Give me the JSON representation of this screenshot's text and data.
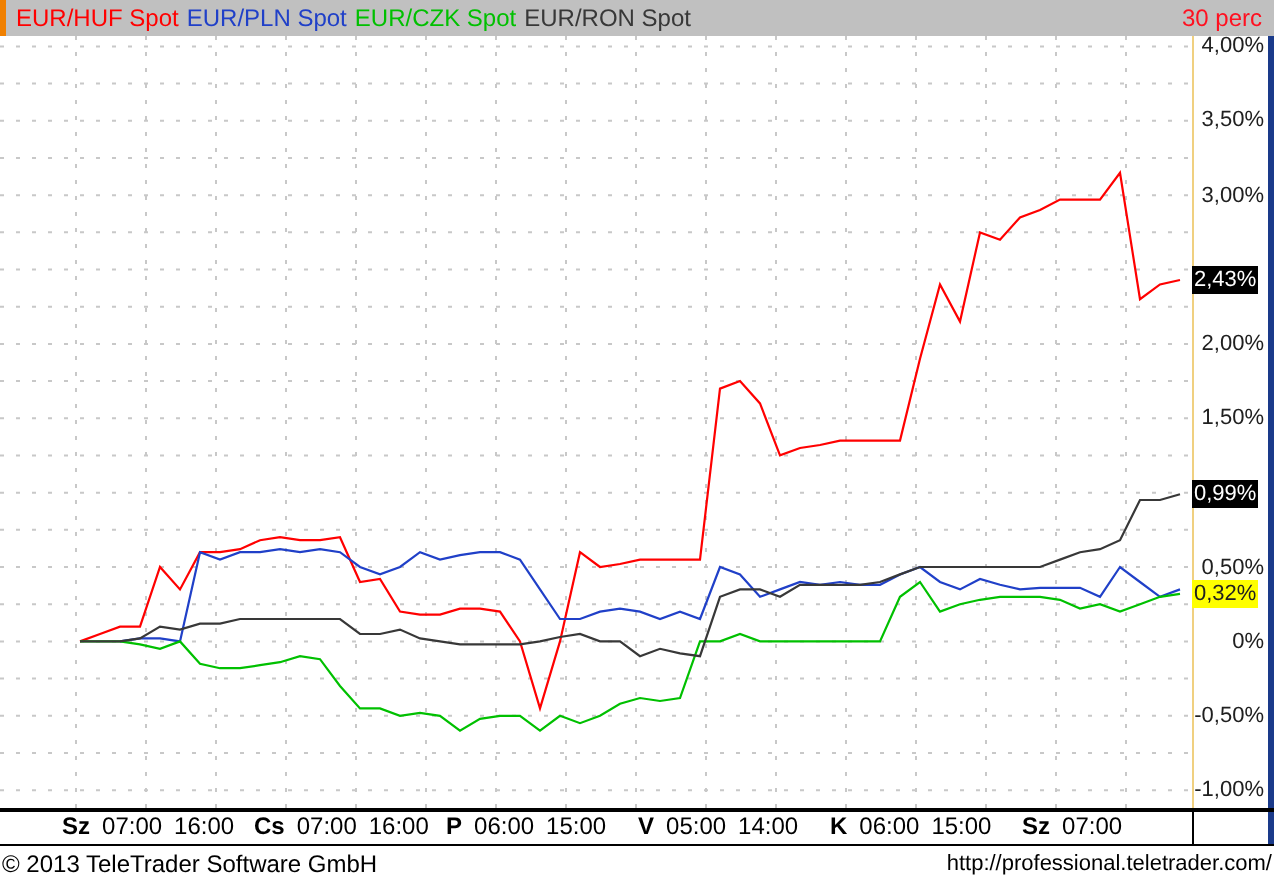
{
  "header": {
    "indicator": "30 perc"
  },
  "chart_data": {
    "type": "line",
    "grid": true,
    "ylim": [
      -1.12,
      4.07
    ],
    "yticks": [
      {
        "value": 4,
        "label": "4,00%"
      },
      {
        "value": 3.5,
        "label": "3,50%"
      },
      {
        "value": 3,
        "label": "3,00%"
      },
      {
        "value": 2,
        "label": "2,00%"
      },
      {
        "value": 1.5,
        "label": "1,50%"
      },
      {
        "value": 0.5,
        "label": "0,50%"
      },
      {
        "value": 0,
        "label": "0%"
      },
      {
        "value": -0.5,
        "label": "-0,50%"
      },
      {
        "value": -1,
        "label": "-1,00%"
      }
    ],
    "series": [
      {
        "name": "EUR/HUF Spot",
        "color": "#ff0000",
        "values": [
          0,
          0.05,
          0.1,
          0.1,
          0.5,
          0.35,
          0.6,
          0.6,
          0.62,
          0.68,
          0.7,
          0.68,
          0.68,
          0.7,
          0.4,
          0.42,
          0.2,
          0.18,
          0.18,
          0.22,
          0.22,
          0.2,
          0.0,
          -0.45,
          0.0,
          0.6,
          0.5,
          0.52,
          0.55,
          0.55,
          0.55,
          0.55,
          1.7,
          1.75,
          1.6,
          1.25,
          1.3,
          1.32,
          1.35,
          1.35,
          1.35,
          1.35,
          1.9,
          2.4,
          2.15,
          2.75,
          2.7,
          2.85,
          2.9,
          2.97,
          2.97,
          2.97,
          3.15,
          2.3,
          2.4,
          2.43
        ]
      },
      {
        "name": "EUR/PLN Spot",
        "color": "#2040c8",
        "values": [
          null,
          null,
          0,
          0.02,
          0.02,
          0,
          0.6,
          0.55,
          0.6,
          0.6,
          0.62,
          0.6,
          0.62,
          0.6,
          0.5,
          0.45,
          0.5,
          0.6,
          0.55,
          0.58,
          0.6,
          0.6,
          0.55,
          0.35,
          0.15,
          0.15,
          0.2,
          0.22,
          0.2,
          0.15,
          0.2,
          0.15,
          0.5,
          0.45,
          0.3,
          0.35,
          0.4,
          0.38,
          0.4,
          0.38,
          0.38,
          0.45,
          0.5,
          0.4,
          0.35,
          0.42,
          0.38,
          0.35,
          0.36,
          0.36,
          0.36,
          0.3,
          0.5,
          0.4,
          0.3,
          0.35
        ]
      },
      {
        "name": "EUR/CZK Spot",
        "color": "#00c000",
        "values": [
          0,
          0,
          0,
          -0.02,
          -0.05,
          0,
          -0.15,
          -0.18,
          -0.18,
          -0.16,
          -0.14,
          -0.1,
          -0.12,
          -0.3,
          -0.45,
          -0.45,
          -0.5,
          -0.48,
          -0.5,
          -0.6,
          -0.52,
          -0.5,
          -0.5,
          -0.6,
          -0.5,
          -0.55,
          -0.5,
          -0.42,
          -0.38,
          -0.4,
          -0.38,
          0.0,
          0.0,
          0.05,
          0.0,
          0.0,
          0.0,
          0.0,
          0.0,
          0.0,
          0.0,
          0.3,
          0.4,
          0.2,
          0.25,
          0.28,
          0.3,
          0.3,
          0.3,
          0.28,
          0.22,
          0.25,
          0.2,
          0.25,
          0.3,
          0.32
        ]
      },
      {
        "name": "EUR/RON Spot",
        "color": "#383838",
        "values": [
          0,
          0,
          0,
          0.02,
          0.1,
          0.08,
          0.12,
          0.12,
          0.15,
          0.15,
          0.15,
          0.15,
          0.15,
          0.15,
          0.05,
          0.05,
          0.08,
          0.02,
          0.0,
          -0.02,
          -0.02,
          -0.02,
          -0.02,
          0.0,
          0.03,
          0.05,
          0.0,
          0.0,
          -0.1,
          -0.05,
          -0.08,
          -0.1,
          0.3,
          0.35,
          0.35,
          0.3,
          0.38,
          0.38,
          0.38,
          0.38,
          0.4,
          0.45,
          0.5,
          0.5,
          0.5,
          0.5,
          0.5,
          0.5,
          0.5,
          0.55,
          0.6,
          0.62,
          0.68,
          0.95,
          0.95,
          0.99
        ]
      }
    ]
  },
  "value_tags": [
    {
      "label": "2,43%",
      "kind": "dark"
    },
    {
      "label": "0,99%",
      "kind": "dark"
    },
    {
      "label": "0,32%",
      "kind": "highlight"
    }
  ],
  "time_axis": [
    {
      "day": "Sz",
      "times": [
        "07:00",
        "16:00"
      ]
    },
    {
      "day": "Cs",
      "times": [
        "07:00",
        "16:00"
      ]
    },
    {
      "day": "P",
      "times": [
        "06:00",
        "15:00"
      ]
    },
    {
      "day": "V",
      "times": [
        "05:00",
        "14:00"
      ]
    },
    {
      "day": "K",
      "times": [
        "06:00",
        "15:00"
      ]
    },
    {
      "day": "Sz",
      "times": [
        "07:00"
      ]
    }
  ],
  "footer": {
    "copyright": "© 2013 TeleTrader Software GmbH",
    "url": "http://professional.teletrader.com/"
  }
}
